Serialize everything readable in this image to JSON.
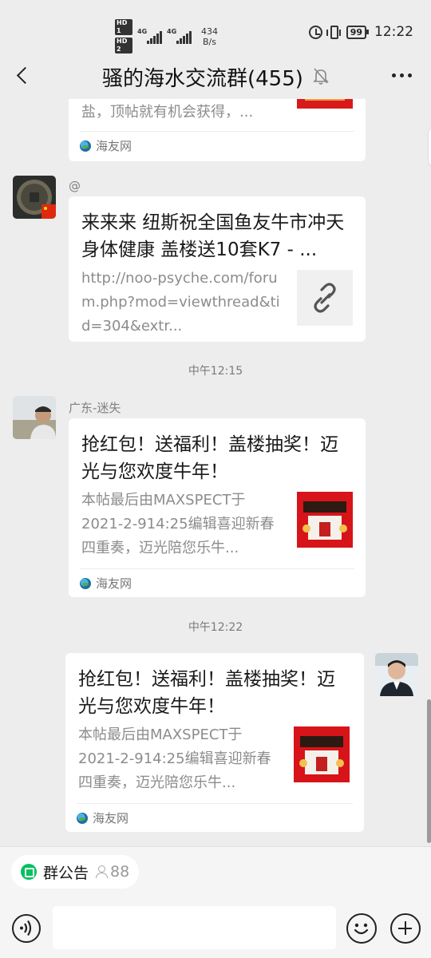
{
  "status_bar": {
    "hd_top": "HD 1",
    "hd_bottom": "HD 2",
    "net_1": "4G",
    "net_2": "4G",
    "speed_value": "434",
    "speed_unit": "B/s",
    "battery": "99",
    "time": "12:22"
  },
  "header": {
    "title": "骚的海水交流群(455)",
    "icons": [
      "back-arrow-icon",
      "muted-bell-icon",
      "more-icon"
    ]
  },
  "messages": [
    {
      "type": "link-card",
      "title": "",
      "description": "盐，顶帖就有机会获得，...",
      "source": "海友网",
      "thumb": "red-promo-image"
    },
    {
      "type": "link-card",
      "sender": "@",
      "title": "来来来 纽斯祝全国鱼友牛市冲天 身体健康 盖楼送10套K7 - ...",
      "description": "http://noo-psyche.com/forum.php?mod=viewthread&tid=304&extr...",
      "thumb": "link-icon"
    },
    {
      "type": "timestamp",
      "text": "中午12:15"
    },
    {
      "type": "link-card",
      "sender": "广东-迷失",
      "title": "抢红包！送福利！盖楼抽奖！迈光与您欢度牛年！",
      "description": "本帖最后由MAXSPECT于2021-2-914:25编辑喜迎新春四重奏，迈光陪您乐牛...",
      "source": "海友网",
      "thumb": "red-promo-image"
    },
    {
      "type": "timestamp",
      "text": "中午12:22"
    },
    {
      "type": "link-card",
      "self": true,
      "title": "抢红包！送福利！盖楼抽奖！迈光与您欢度牛年！",
      "description": "本帖最后由MAXSPECT于2021-2-914:25编辑喜迎新春四重奏，迈光陪您乐牛...",
      "source": "海友网",
      "thumb": "red-promo-image"
    }
  ],
  "notice": {
    "label": "群公告",
    "count": "88"
  },
  "input": {
    "placeholder": ""
  },
  "colors": {
    "background": "#ededed",
    "card": "#ffffff",
    "accent": "#07c160",
    "muted_text": "#8c8c8c"
  }
}
